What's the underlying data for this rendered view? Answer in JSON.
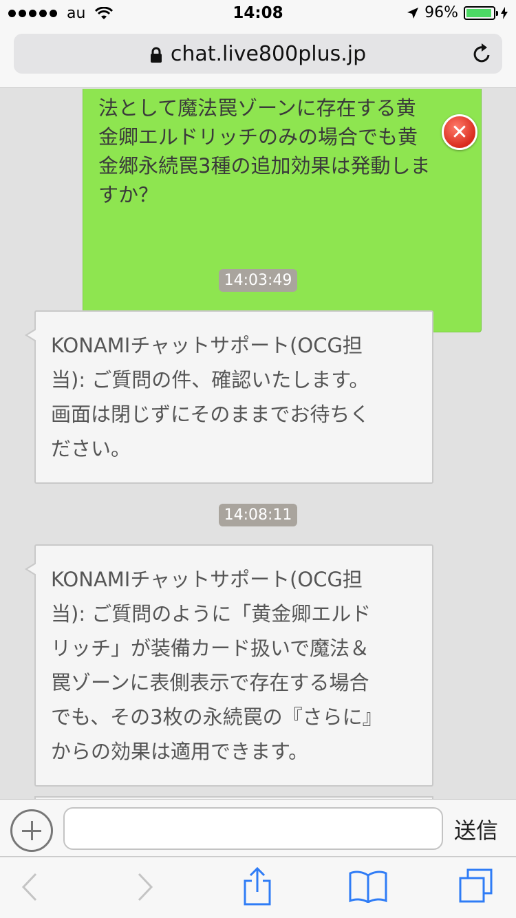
{
  "status_bar": {
    "carrier": "au",
    "time": "14:08",
    "battery_percent": "96%",
    "battery_level": 0.96
  },
  "browser": {
    "url": "chat.live800plus.jp",
    "icons": [
      "lock-icon",
      "reload-icon",
      "back-icon",
      "forward-icon",
      "share-icon",
      "bookmarks-icon",
      "tabs-icon"
    ]
  },
  "chat": {
    "user_message": "法として魔法罠ゾーンに存在する黄\n金卿エルドリッチのみの場合でも黄\n金郷永続罠3種の追加効果は発動しま\nすか？",
    "messages": [
      {
        "timestamp": "14:03:49",
        "text": "KONAMIチャットサポート(OCG担\n当): ご質問の件、確認いたします。\n画面は閉じずにそのままでお待ちく\nださい。"
      },
      {
        "timestamp": "14:08:11",
        "text": "KONAMIチャットサポート(OCG担\n当): ご質問のように「黄金卿エルド\nリッチ」が装備カード扱いで魔法＆\n罠ゾーンに表側表示で存在する場合\nでも、その3枚の永続罠の『さらに』\nからの効果は適用できます。"
      }
    ]
  },
  "input_bar": {
    "value": "",
    "send_label": "送信"
  },
  "colors": {
    "user_bubble": "#8ee550",
    "agent_bubble": "#f5f5f5",
    "timestamp_bg": "#a9a49d",
    "ios_blue": "#2f7cf6",
    "error_red": "#d92b1e"
  }
}
